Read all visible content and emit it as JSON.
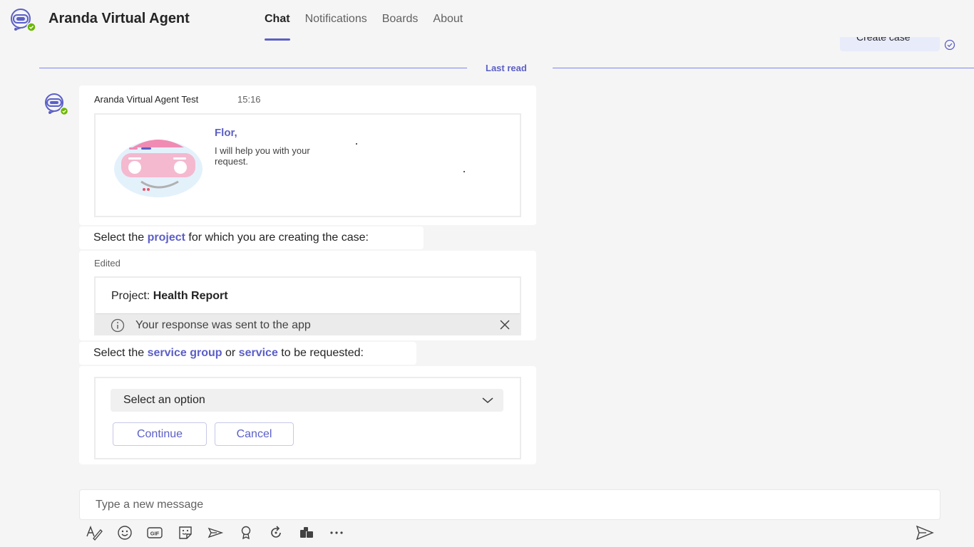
{
  "app": {
    "title": "Aranda Virtual Agent",
    "logo_icon": "bot-headset-icon",
    "presence_color": "#6bb700"
  },
  "tabs": [
    {
      "label": "Chat",
      "active": true
    },
    {
      "label": "Notifications",
      "active": false
    },
    {
      "label": "Boards",
      "active": false
    },
    {
      "label": "About",
      "active": false
    }
  ],
  "previous_message": {
    "text": "Create case"
  },
  "divider": {
    "label": "Last read"
  },
  "message": {
    "sender": "Aranda Virtual Agent Test",
    "time": "15:16",
    "greeting_name": "Flor,",
    "greeting_text": "I will help you with your request.",
    "prompt1": {
      "pre": "Select the ",
      "highlight": "project",
      "post": " for which you are creating the case:"
    },
    "edited_label": "Edited",
    "project_label": "Project: ",
    "project_value": "Health Report",
    "notice_text": "Your response was sent to the app",
    "prompt2": {
      "pre": "Select the ",
      "highlight1": "service group",
      "mid": " or ",
      "highlight2": "service",
      "post": " to be requested:"
    },
    "select_placeholder": "Select an option",
    "continue_label": "Continue",
    "cancel_label": "Cancel"
  },
  "compose": {
    "placeholder": "Type a new message",
    "tools": [
      "format-icon",
      "emoji-icon",
      "gif-icon",
      "sticker-icon",
      "meet-icon",
      "praise-icon",
      "loop-icon",
      "apps-icon",
      "more-icon"
    ]
  },
  "colors": {
    "accent": "#5b5fc7",
    "background": "#f5f5f5"
  }
}
